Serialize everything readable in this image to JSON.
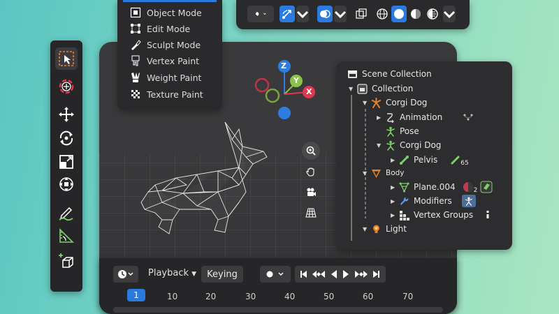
{
  "mode_menu": {
    "items": [
      {
        "label": "Object Mode",
        "icon": "object-mode-icon"
      },
      {
        "label": "Edit Mode",
        "icon": "edit-mode-icon"
      },
      {
        "label": "Sculpt Mode",
        "icon": "sculpt-mode-icon"
      },
      {
        "label": "Vertex Paint",
        "icon": "vertex-paint-icon"
      },
      {
        "label": "Weight Paint",
        "icon": "weight-paint-icon"
      },
      {
        "label": "Texture Paint",
        "icon": "texture-paint-icon"
      }
    ]
  },
  "gizmo": {
    "z": "Z",
    "y": "Y",
    "x": "X"
  },
  "outliner": {
    "root": "Scene Collection",
    "rows": [
      {
        "label": "Collection"
      },
      {
        "label": "Corgi Dog"
      },
      {
        "label": "Animation"
      },
      {
        "label": "Pose"
      },
      {
        "label": "Corgi Dog"
      },
      {
        "label": "Pelvis",
        "badge": "65"
      },
      {
        "label": "Body"
      },
      {
        "label": "Plane.004",
        "badge": "2"
      },
      {
        "label": "Modifiers"
      },
      {
        "label": "Vertex Groups"
      },
      {
        "label": "Light"
      }
    ]
  },
  "timeline": {
    "playback": "Playback",
    "keying": "Keying",
    "current_frame": "1",
    "ticks": [
      "10",
      "20",
      "30",
      "40",
      "50",
      "60",
      "70"
    ]
  },
  "colors": {
    "accent": "#2a7ae0",
    "object_orange": "#e8822c",
    "armature_green": "#7ed06a",
    "gizmo_x": "#e0384f",
    "gizmo_y": "#8bc34a",
    "gizmo_z": "#2f7de1"
  }
}
